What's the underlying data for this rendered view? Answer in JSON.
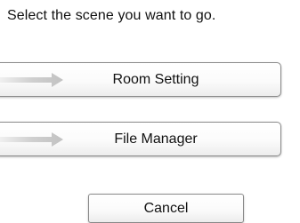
{
  "dialog": {
    "prompt": "Select the scene you want to go."
  },
  "options": [
    {
      "label": "Room Setting",
      "icon": "arrow-right-icon"
    },
    {
      "label": "File Manager",
      "icon": "arrow-right-icon"
    }
  ],
  "actions": {
    "cancel_label": "Cancel"
  },
  "colors": {
    "arrow": "#c4c4c4",
    "button_border": "#8a8a8a",
    "text": "#111111"
  }
}
